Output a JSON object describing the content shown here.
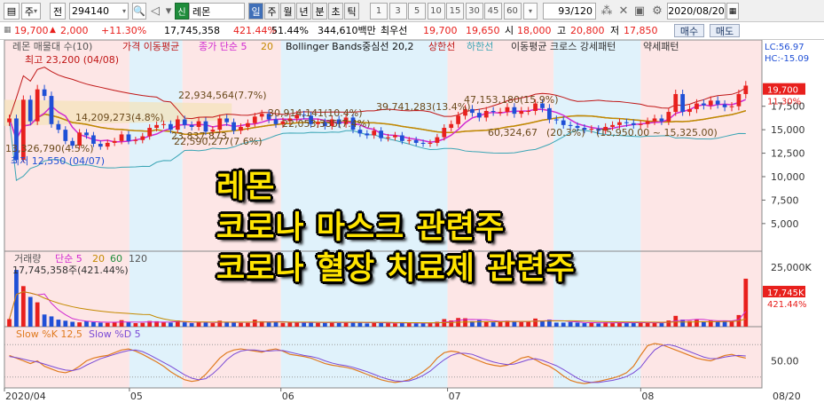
{
  "toolbar": {
    "mode": "주",
    "mode_arrow": "▾",
    "prev_label": "전",
    "code": "294140",
    "code_arrow": "▾",
    "name_badge": "신",
    "name": "레몬",
    "periods": [
      "일",
      "주",
      "월",
      "년",
      "분",
      "초",
      "틱"
    ],
    "ticks": [
      "1",
      "3",
      "5",
      "10",
      "15",
      "30",
      "45",
      "60"
    ],
    "tick_arrow": "▾",
    "count": "93/120",
    "date": "2020/08/20"
  },
  "quote": {
    "price": "19,700",
    "change": "2,000",
    "pct": "+11.30%",
    "volume": "17,745,358",
    "volume_pct": "421.44%",
    "turnover": "51.44%",
    "amount": "344,610백만",
    "preferred": "최우선",
    "ask": "19,700",
    "bid": "19,650",
    "open_label": "시",
    "open": "18,000",
    "high_label": "고",
    "high": "20,800",
    "low_label": "저",
    "low": "17,850",
    "buy": "매수",
    "sell": "매도"
  },
  "legend": {
    "stock": "레몬 매물대 수(10)",
    "ma": "가격 이동평균",
    "ma5": "종가 단순 5",
    "ma20": "20",
    "bb": "Bollinger Bands중심선 20,2",
    "bb_up": "상한선",
    "bb_low": "하한선",
    "cross": "이동평균 크로스 강세패턴",
    "weak": "약세패턴"
  },
  "price_axis": {
    "lc": "LC:56.97",
    "hc": "HC:-15.09",
    "ticks": [
      "17,500",
      "15,000",
      "12,500",
      "10,000",
      "7,500",
      "5,000"
    ],
    "last": "19,700",
    "last_pct": "11.30%"
  },
  "annotations": {
    "high": "최고 23,200 (04/08)",
    "low": "최저 12,550 (04/07)",
    "v1": "22,934,564(7.7%)",
    "v2": "14,209,273(4.8%)",
    "v3": "30,914,141(10.4%)",
    "v4": "39,741,283(13.4%)",
    "v5": "47,153,180(15.9%)",
    "v6": "22,590,277(7.6%)",
    "v7": "22,053,335(7.4%)",
    "v8": "60,324,67",
    "v9": "(20.3%)",
    "v10": "(15,950.00 ~ 15,325.00)",
    "v11": "13,326,790(4.5%)",
    "v12": "23,837,873"
  },
  "vol_legend": {
    "title": "거래량",
    "ma5": "단순 5",
    "ma20": "20",
    "ma60": "60",
    "ma120": "120",
    "peak": "17,745,358주(421.44%)"
  },
  "vol_axis": {
    "tick": "25,000K",
    "last": "17,745K",
    "pct": "421.44%"
  },
  "stoch": {
    "k": "Slow %K 12,5",
    "d": "Slow %D 5",
    "tick": "50.00"
  },
  "xaxis": [
    "2020/04",
    "05",
    "06",
    "07",
    "08",
    "08/20"
  ],
  "overlay": [
    "레몬",
    "코로나 마스크 관련주",
    "코로나 혈장 치료제 관련주"
  ],
  "colors": {
    "up": "#e8201d",
    "down": "#1f4fd6",
    "band_pink": "#fde6e6",
    "band_blue": "#e0f2fb"
  },
  "chart_data": {
    "type": "candlestick",
    "categories": [
      "04",
      "05",
      "06",
      "07",
      "08"
    ],
    "close": [
      16200,
      11800,
      18200,
      15900,
      19300,
      18600,
      15600,
      15000,
      13800,
      13300,
      14700,
      14400,
      13500,
      13200,
      13600,
      13800,
      14500,
      13800,
      13900,
      14300,
      15200,
      15500,
      15600,
      15000,
      16100,
      15500,
      15300,
      15900,
      14800,
      15000,
      16200,
      15800,
      14900,
      15300,
      15700,
      16400,
      16700,
      16100,
      15600,
      15900,
      16200,
      16600,
      16500,
      15600,
      15800,
      15400,
      16100,
      15600,
      16300,
      15000,
      14600,
      14400,
      14900,
      14100,
      14200,
      14400,
      13800,
      13900,
      13600,
      13500,
      13600,
      14200,
      15200,
      15600,
      16500,
      17200,
      16800,
      16300,
      17000,
      16900,
      16900,
      17400,
      16700,
      17000,
      17000,
      17800,
      17300,
      16100,
      16000,
      15500,
      15400,
      15200,
      15000,
      15100,
      14900,
      15300,
      15500,
      15800,
      15700,
      15500,
      15600,
      15900,
      16200,
      15900,
      16900,
      18800,
      16900,
      17200,
      17800,
      17600,
      18100,
      17700,
      17400,
      17500,
      18800,
      19700
    ],
    "volume": [
      2800,
      21000,
      15000,
      11000,
      9000,
      4500,
      3800,
      2600,
      2200,
      1800,
      1600,
      2000,
      1700,
      1500,
      1400,
      1600,
      2400,
      1700,
      1300,
      1400,
      2100,
      2000,
      1600,
      1500,
      2300,
      1600,
      1300,
      1800,
      1500,
      1300,
      2200,
      1600,
      1500,
      1400,
      1400,
      2600,
      2000,
      1600,
      1700,
      1400,
      1500,
      1700,
      1600,
      1500,
      1400,
      1400,
      1800,
      1400,
      1500,
      1700,
      1500,
      1200,
      1600,
      1400,
      1300,
      1200,
      1600,
      1400,
      1200,
      1200,
      1400,
      1800,
      2800,
      2300,
      3200,
      3100,
      2000,
      2400,
      2000,
      1600,
      1800,
      2200,
      2000,
      1700,
      1800,
      3000,
      2200,
      2600,
      1500,
      1500,
      1700,
      1500,
      1300,
      1400,
      1200,
      1600,
      1500,
      1600,
      1300,
      1300,
      1600,
      1500,
      1500,
      1300,
      2300,
      4000,
      2600,
      2100,
      2600,
      2000,
      2300,
      1900,
      2100,
      2300,
      4300,
      17745
    ],
    "stoch_k": [
      60,
      55,
      50,
      45,
      50,
      40,
      35,
      30,
      28,
      32,
      40,
      50,
      55,
      58,
      60,
      65,
      70,
      72,
      68,
      62,
      55,
      48,
      40,
      30,
      22,
      15,
      12,
      14,
      25,
      40,
      55,
      65,
      70,
      72,
      70,
      68,
      66,
      70,
      72,
      68,
      62,
      60,
      58,
      55,
      50,
      45,
      42,
      40,
      38,
      35,
      30,
      25,
      20,
      15,
      12,
      10,
      12,
      15,
      22,
      30,
      40,
      55,
      65,
      68,
      66,
      60,
      55,
      50,
      45,
      42,
      40,
      42,
      48,
      55,
      58,
      52,
      45,
      40,
      32,
      22,
      14,
      10,
      8,
      10,
      12,
      15,
      18,
      22,
      28,
      40,
      60,
      78,
      82,
      80,
      75,
      70,
      65,
      60,
      55,
      52,
      50,
      55,
      60,
      62,
      58,
      55
    ],
    "stoch_d": [
      58,
      56,
      53,
      50,
      48,
      44,
      40,
      36,
      33,
      32,
      35,
      42,
      48,
      54,
      58,
      62,
      66,
      69,
      70,
      67,
      61,
      54,
      47,
      40,
      32,
      24,
      18,
      15,
      17,
      26,
      38,
      52,
      62,
      68,
      70,
      70,
      68,
      68,
      69,
      69,
      66,
      63,
      60,
      58,
      55,
      50,
      46,
      43,
      41,
      38,
      34,
      30,
      25,
      20,
      16,
      13,
      12,
      13,
      17,
      23,
      31,
      42,
      52,
      60,
      64,
      64,
      62,
      57,
      52,
      48,
      45,
      43,
      44,
      48,
      52,
      54,
      51,
      46,
      41,
      34,
      26,
      18,
      12,
      10,
      10,
      12,
      14,
      17,
      21,
      28,
      38,
      55,
      70,
      78,
      80,
      77,
      72,
      67,
      62,
      57,
      54,
      54,
      57,
      59,
      60,
      59
    ]
  }
}
